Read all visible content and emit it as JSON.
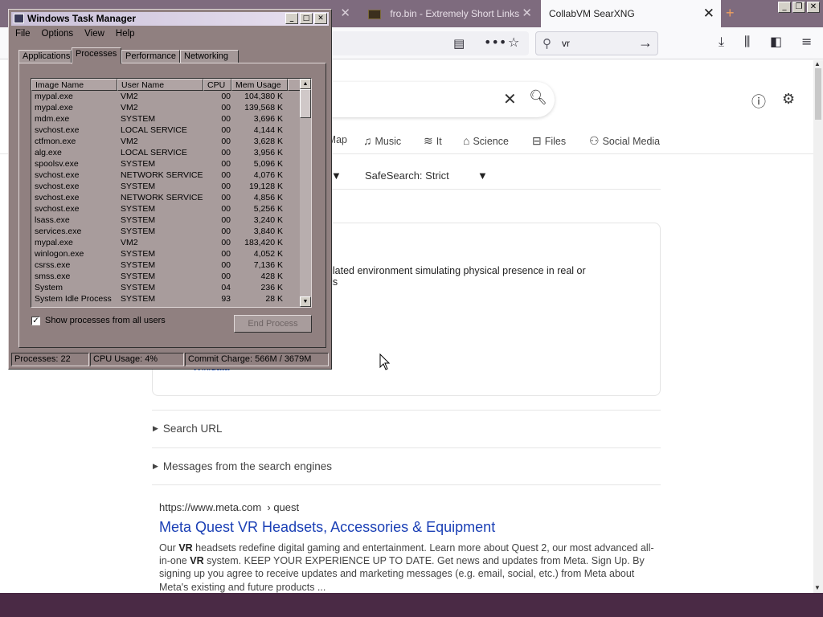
{
  "browser": {
    "tabs": [
      {
        "label": "",
        "active": false
      },
      {
        "label": "fro.bin - Extremely Short Links",
        "active": false
      },
      {
        "label": "CollabVM SearXNG",
        "active": true
      }
    ],
    "search_box": {
      "value": "vr"
    }
  },
  "page": {
    "categories": [
      {
        "icon": "map-icon",
        "label": "Map"
      },
      {
        "icon": "music-icon",
        "label": "Music"
      },
      {
        "icon": "layers-icon",
        "label": "It"
      },
      {
        "icon": "graduation-cap-icon",
        "label": "Science"
      },
      {
        "icon": "inbox-icon",
        "label": "Files"
      },
      {
        "icon": "people-icon",
        "label": "Social Media"
      }
    ],
    "safesearch_label": "SafeSearch: Strict",
    "infobox": {
      "desc_line1": "nulated environment simulating physical presence in real or",
      "desc_line2": "rlds",
      "link": "Wikidata"
    },
    "details": {
      "search_url": "Search URL",
      "engine_messages": "Messages from the search engines"
    },
    "result": {
      "url": "https://www.meta.com",
      "url_path": "› quest",
      "title": "Meta Quest VR Headsets, Accessories & Equipment",
      "snippet_parts": [
        {
          "t": "Our ",
          "b": false
        },
        {
          "t": "VR",
          "b": true
        },
        {
          "t": " headsets redefine digital gaming and entertainment. Learn more about Quest 2, our most advanced all-in-one ",
          "b": false
        },
        {
          "t": "VR",
          "b": true
        },
        {
          "t": " system. KEEP YOUR EXPERIENCE UP TO DATE. Get news and updates from Meta. Sign Up. By signing up you agree to receive updates and marketing messages (e.g. email, social, etc.) from Meta about Meta's existing and future products ...",
          "b": false
        }
      ]
    }
  },
  "task_manager": {
    "title": "Windows Task Manager",
    "menu": [
      "File",
      "Options",
      "View",
      "Help"
    ],
    "tabs": [
      "Applications",
      "Processes",
      "Performance",
      "Networking"
    ],
    "active_tab": "Processes",
    "columns": [
      "Image Name",
      "User Name",
      "CPU",
      "Mem Usage"
    ],
    "processes": [
      [
        "mypal.exe",
        "VM2",
        "00",
        "104,380 K"
      ],
      [
        "mypal.exe",
        "VM2",
        "00",
        "139,568 K"
      ],
      [
        "mdm.exe",
        "SYSTEM",
        "00",
        "3,696 K"
      ],
      [
        "svchost.exe",
        "LOCAL SERVICE",
        "00",
        "4,144 K"
      ],
      [
        "ctfmon.exe",
        "VM2",
        "00",
        "3,628 K"
      ],
      [
        "alg.exe",
        "LOCAL SERVICE",
        "00",
        "3,956 K"
      ],
      [
        "spoolsv.exe",
        "SYSTEM",
        "00",
        "5,096 K"
      ],
      [
        "svchost.exe",
        "NETWORK SERVICE",
        "00",
        "4,076 K"
      ],
      [
        "svchost.exe",
        "SYSTEM",
        "00",
        "19,128 K"
      ],
      [
        "svchost.exe",
        "NETWORK SERVICE",
        "00",
        "4,856 K"
      ],
      [
        "svchost.exe",
        "SYSTEM",
        "00",
        "5,256 K"
      ],
      [
        "lsass.exe",
        "SYSTEM",
        "00",
        "3,240 K"
      ],
      [
        "services.exe",
        "SYSTEM",
        "00",
        "3,840 K"
      ],
      [
        "mypal.exe",
        "VM2",
        "00",
        "183,420 K"
      ],
      [
        "winlogon.exe",
        "SYSTEM",
        "00",
        "4,052 K"
      ],
      [
        "csrss.exe",
        "SYSTEM",
        "00",
        "7,136 K"
      ],
      [
        "smss.exe",
        "SYSTEM",
        "00",
        "428 K"
      ],
      [
        "System",
        "SYSTEM",
        "04",
        "236 K"
      ],
      [
        "System Idle Process",
        "SYSTEM",
        "93",
        "28 K"
      ]
    ],
    "show_all_label": "Show processes from all users",
    "show_all_checked": true,
    "end_process_label": "End Process",
    "status": {
      "processes": "Processes: 22",
      "cpu": "CPU Usage: 4%",
      "commit": "Commit Charge: 566M / 3679M"
    }
  }
}
